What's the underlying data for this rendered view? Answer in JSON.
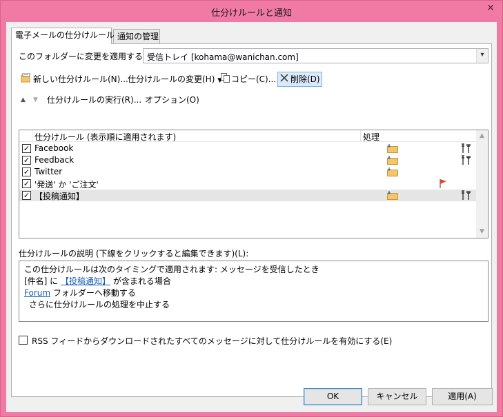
{
  "window": {
    "title": "仕分けルールと通知",
    "close_glyph": "✕"
  },
  "tabs": [
    {
      "label": "電子メールの仕分けルール",
      "active": true
    },
    {
      "label": "通知の管理",
      "active": false
    }
  ],
  "folder_apply": {
    "label": "このフォルダーに変更を適用する(F):",
    "value": "受信トレイ [kohama@wanichan.com]"
  },
  "toolbar": {
    "new_rule": "新しい仕分けルール(N)...",
    "change_rule": "仕分けルールの変更(H)",
    "copy": "コピー(C)...",
    "delete": "削除(D)",
    "run_rules": "仕分けルールの実行(R)...",
    "options": "オプション(O)"
  },
  "rules_list": {
    "columns": {
      "rule": "仕分けルール (表示順に適用されます)",
      "action": "処理"
    },
    "rows": [
      {
        "name": "Facebook",
        "checked": true,
        "folder_icon": true,
        "flag_icon": false,
        "tool_icon": true,
        "selected": false
      },
      {
        "name": "Feedback",
        "checked": true,
        "folder_icon": true,
        "flag_icon": false,
        "tool_icon": true,
        "selected": false
      },
      {
        "name": "Twitter",
        "checked": true,
        "folder_icon": true,
        "flag_icon": false,
        "tool_icon": false,
        "selected": false
      },
      {
        "name": "'発送' か 'ご注文'",
        "checked": true,
        "folder_icon": false,
        "flag_icon": true,
        "tool_icon": false,
        "selected": false
      },
      {
        "name": "【投稿通知】",
        "checked": true,
        "folder_icon": true,
        "flag_icon": false,
        "tool_icon": true,
        "selected": true
      }
    ]
  },
  "description": {
    "label": "仕分けルールの説明 (下線をクリックすると編集できます)(L):",
    "line1": "この仕分けルールは次のタイミングで適用されます: メッセージを受信したとき",
    "line2_prefix": "[件名] に ",
    "line2_link": "【投稿通知】",
    "line2_suffix": " が含まれる場合",
    "line3_link": "Forum",
    "line3_suffix": " フォルダーへ移動する",
    "line4": "さらに仕分けルールの処理を中止する"
  },
  "rss_option": {
    "label": "RSS フィードからダウンロードされたすべてのメッセージに対して仕分けルールを有効にする(E)",
    "checked": false
  },
  "buttons": {
    "ok": "OK",
    "cancel": "キャンセル",
    "apply": "適用(A)"
  },
  "colors": {
    "title_bar": "#f07aa3",
    "link": "#1a5fb4",
    "selected_row": "#e5e5e5",
    "flag": "#e0452f",
    "folder": "#f4c56b"
  }
}
